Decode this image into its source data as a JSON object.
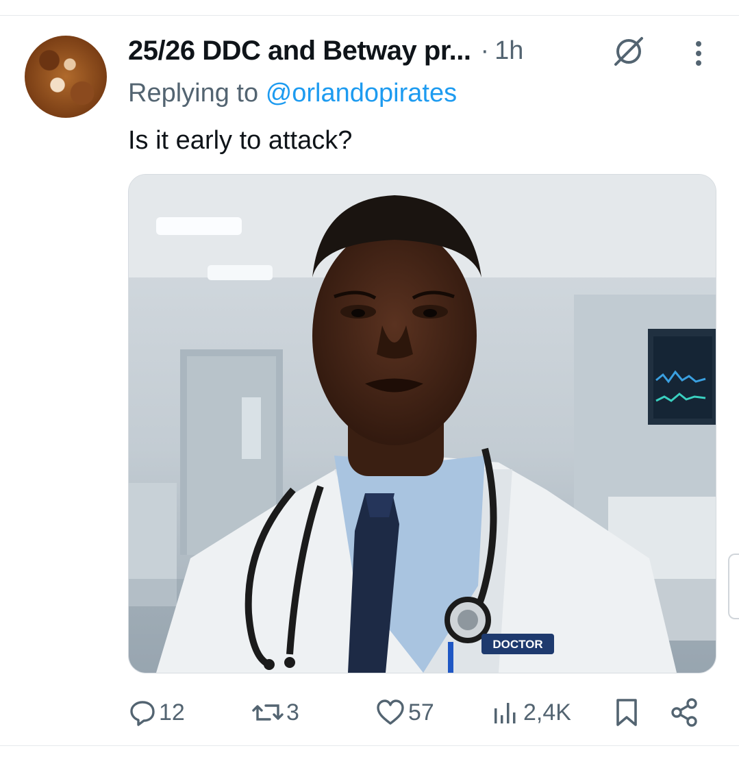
{
  "post": {
    "display_name": "25/26 DDC and Betway pr...",
    "separator": "·",
    "time_ago": "1h",
    "replying_prefix": "Replying to",
    "replying_handle": "@orlandopirates",
    "text": "Is it early to attack?",
    "media": {
      "badge_text": "DOCTOR"
    }
  },
  "icons": {
    "grok": "grok-icon",
    "more": "more-vertical-icon",
    "reply": "reply-icon",
    "repost": "repost-icon",
    "like": "heart-icon",
    "views": "views-chart-icon",
    "bookmark": "bookmark-icon",
    "share": "share-icon"
  },
  "actions": {
    "replies": "12",
    "reposts": "3",
    "likes": "57",
    "views": "2,4K"
  },
  "colors": {
    "accent": "#1d9bf0",
    "muted": "#536471",
    "text": "#0f1419"
  }
}
